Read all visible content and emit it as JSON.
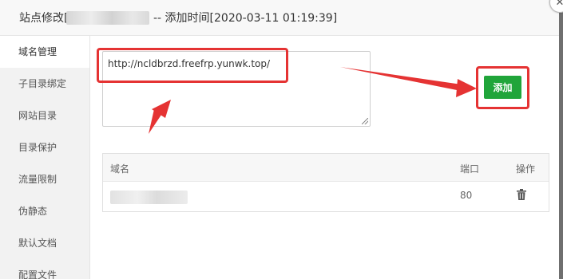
{
  "dialog": {
    "title_prefix": "站点修改[",
    "title_suffix": "-- 添加时间[2020-03-11 01:19:39]",
    "close_symbol": "✕"
  },
  "sidebar": {
    "items": [
      {
        "label": "域名管理"
      },
      {
        "label": "子目录绑定"
      },
      {
        "label": "网站目录"
      },
      {
        "label": "目录保护"
      },
      {
        "label": "流量限制"
      },
      {
        "label": "伪静态"
      },
      {
        "label": "默认文档"
      },
      {
        "label": "配置文件"
      }
    ]
  },
  "domain_form": {
    "textarea_value": "http://ncldbrzd.freefrp.yunwk.top/",
    "add_label": "添加"
  },
  "table": {
    "headers": {
      "domain": "域名",
      "port": "端口",
      "action": "操作"
    },
    "rows": [
      {
        "port": "80"
      }
    ]
  },
  "colors": {
    "accent": "#20a53a",
    "highlight": "#e53333"
  },
  "icons": {
    "delete": "trash-icon",
    "close": "close-icon"
  }
}
